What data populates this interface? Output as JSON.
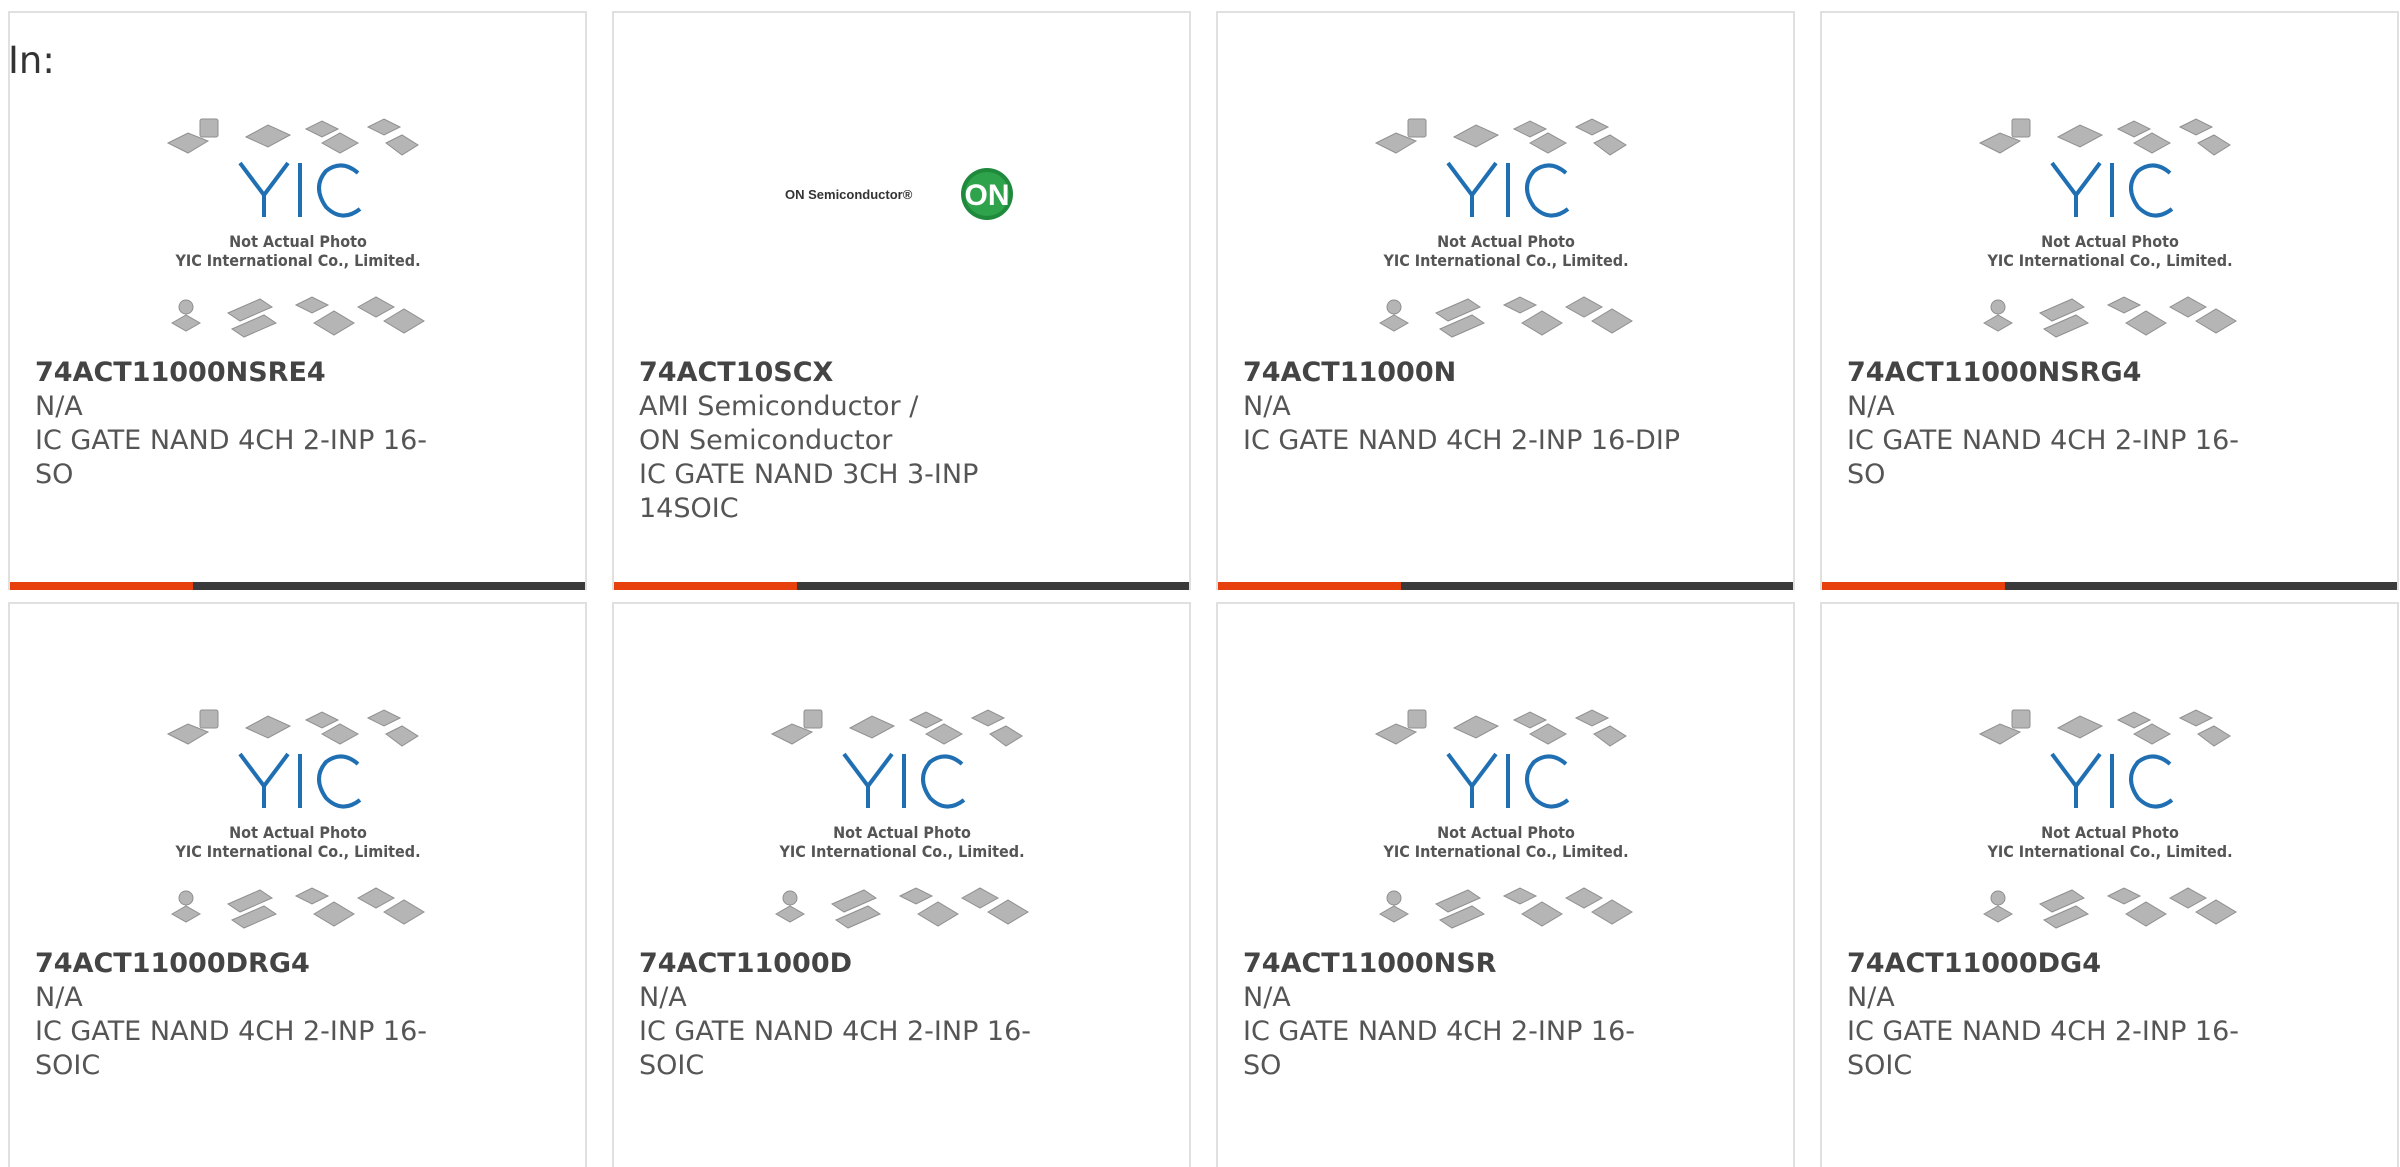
{
  "header": {
    "in_label": "In:"
  },
  "placeholder": {
    "logo": "YIC",
    "caption_line1": "Not Actual Photo",
    "caption_line2": "YIC International Co., Limited."
  },
  "on_semi": {
    "brand_text": "ON Semiconductor®",
    "logo_letters": "ON"
  },
  "colors": {
    "accent": "#e8400c",
    "bar": "#3a3a3a",
    "logo_blue": "#1f6fb2"
  },
  "products": [
    {
      "part": "74ACT11000NSRE4",
      "maker": "N/A",
      "desc": "IC GATE NAND 4CH 2-INP 16-SO",
      "image": "yic-placeholder"
    },
    {
      "part": "74ACT10SCX",
      "maker": "AMI Semiconductor / ON Semiconductor",
      "desc": "IC GATE NAND 3CH 3-INP 14SOIC",
      "image": "on-semiconductor-logo"
    },
    {
      "part": "74ACT11000N",
      "maker": "N/A",
      "desc": "IC GATE NAND 4CH 2-INP 16-DIP",
      "image": "yic-placeholder"
    },
    {
      "part": "74ACT11000NSRG4",
      "maker": "N/A",
      "desc": "IC GATE NAND 4CH 2-INP 16-SO",
      "image": "yic-placeholder"
    },
    {
      "part": "74ACT11000DRG4",
      "maker": "N/A",
      "desc": "IC GATE NAND 4CH 2-INP 16-SOIC",
      "image": "yic-placeholder"
    },
    {
      "part": "74ACT11000D",
      "maker": "N/A",
      "desc": "IC GATE NAND 4CH 2-INP 16-SOIC",
      "image": "yic-placeholder"
    },
    {
      "part": "74ACT11000NSR",
      "maker": "N/A",
      "desc": "IC GATE NAND 4CH 2-INP 16-SO",
      "image": "yic-placeholder"
    },
    {
      "part": "74ACT11000DG4",
      "maker": "N/A",
      "desc": "IC GATE NAND 4CH 2-INP 16-SOIC",
      "image": "yic-placeholder"
    }
  ]
}
